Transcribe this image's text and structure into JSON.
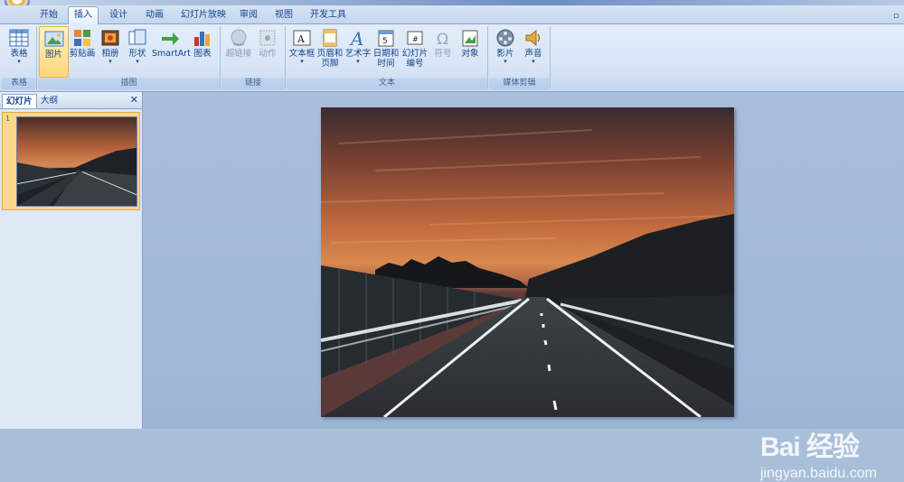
{
  "tabs": [
    "开始",
    "插入",
    "设计",
    "动画",
    "幻灯片放映",
    "审阅",
    "视图",
    "开发工具"
  ],
  "active_tab": "插入",
  "ribbon": {
    "table_group": {
      "label": "表格",
      "buttons": [
        "表格"
      ]
    },
    "illustrations_group": {
      "label": "插图",
      "buttons": [
        "图片",
        "剪贴画",
        "相册",
        "形状",
        "SmartArt",
        "图表"
      ]
    },
    "links_group": {
      "label": "链接",
      "buttons": [
        "超链接",
        "动作"
      ]
    },
    "text_group": {
      "label": "文本",
      "buttons": [
        "文本框",
        "页眉和页脚",
        "艺术字",
        "日期和时间",
        "幻灯片编号",
        "符号",
        "对象"
      ]
    },
    "media_group": {
      "label": "媒体剪辑",
      "buttons": [
        "影片",
        "声音"
      ]
    }
  },
  "pane": {
    "tabs": [
      "幻灯片",
      "大纲"
    ],
    "slide_number": "1"
  },
  "watermark": {
    "logo": "Bai 经验",
    "url": "jingyan.baidu.com"
  },
  "colors": {
    "ribbon_bg": "#dbe7f6",
    "accent_text": "#15428b",
    "highlight": "#ffd77a"
  }
}
